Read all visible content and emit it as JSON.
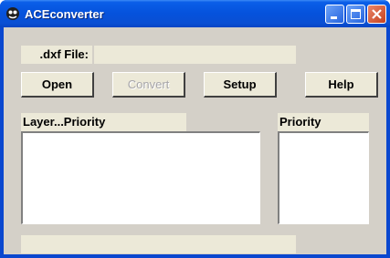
{
  "window": {
    "title": "ACEconverter"
  },
  "file": {
    "label": ".dxf File:",
    "value": ""
  },
  "buttons": {
    "open": "Open",
    "convert": "Convert",
    "setup": "Setup",
    "help": "Help"
  },
  "lists": {
    "layer_header": "Layer...Priority",
    "priority_header": "Priority"
  },
  "status": {
    "text": ""
  },
  "colors": {
    "titlebar": "#0552dc",
    "client": "#d4d0c8",
    "panel": "#ece9d8",
    "close": "#c6421f"
  }
}
